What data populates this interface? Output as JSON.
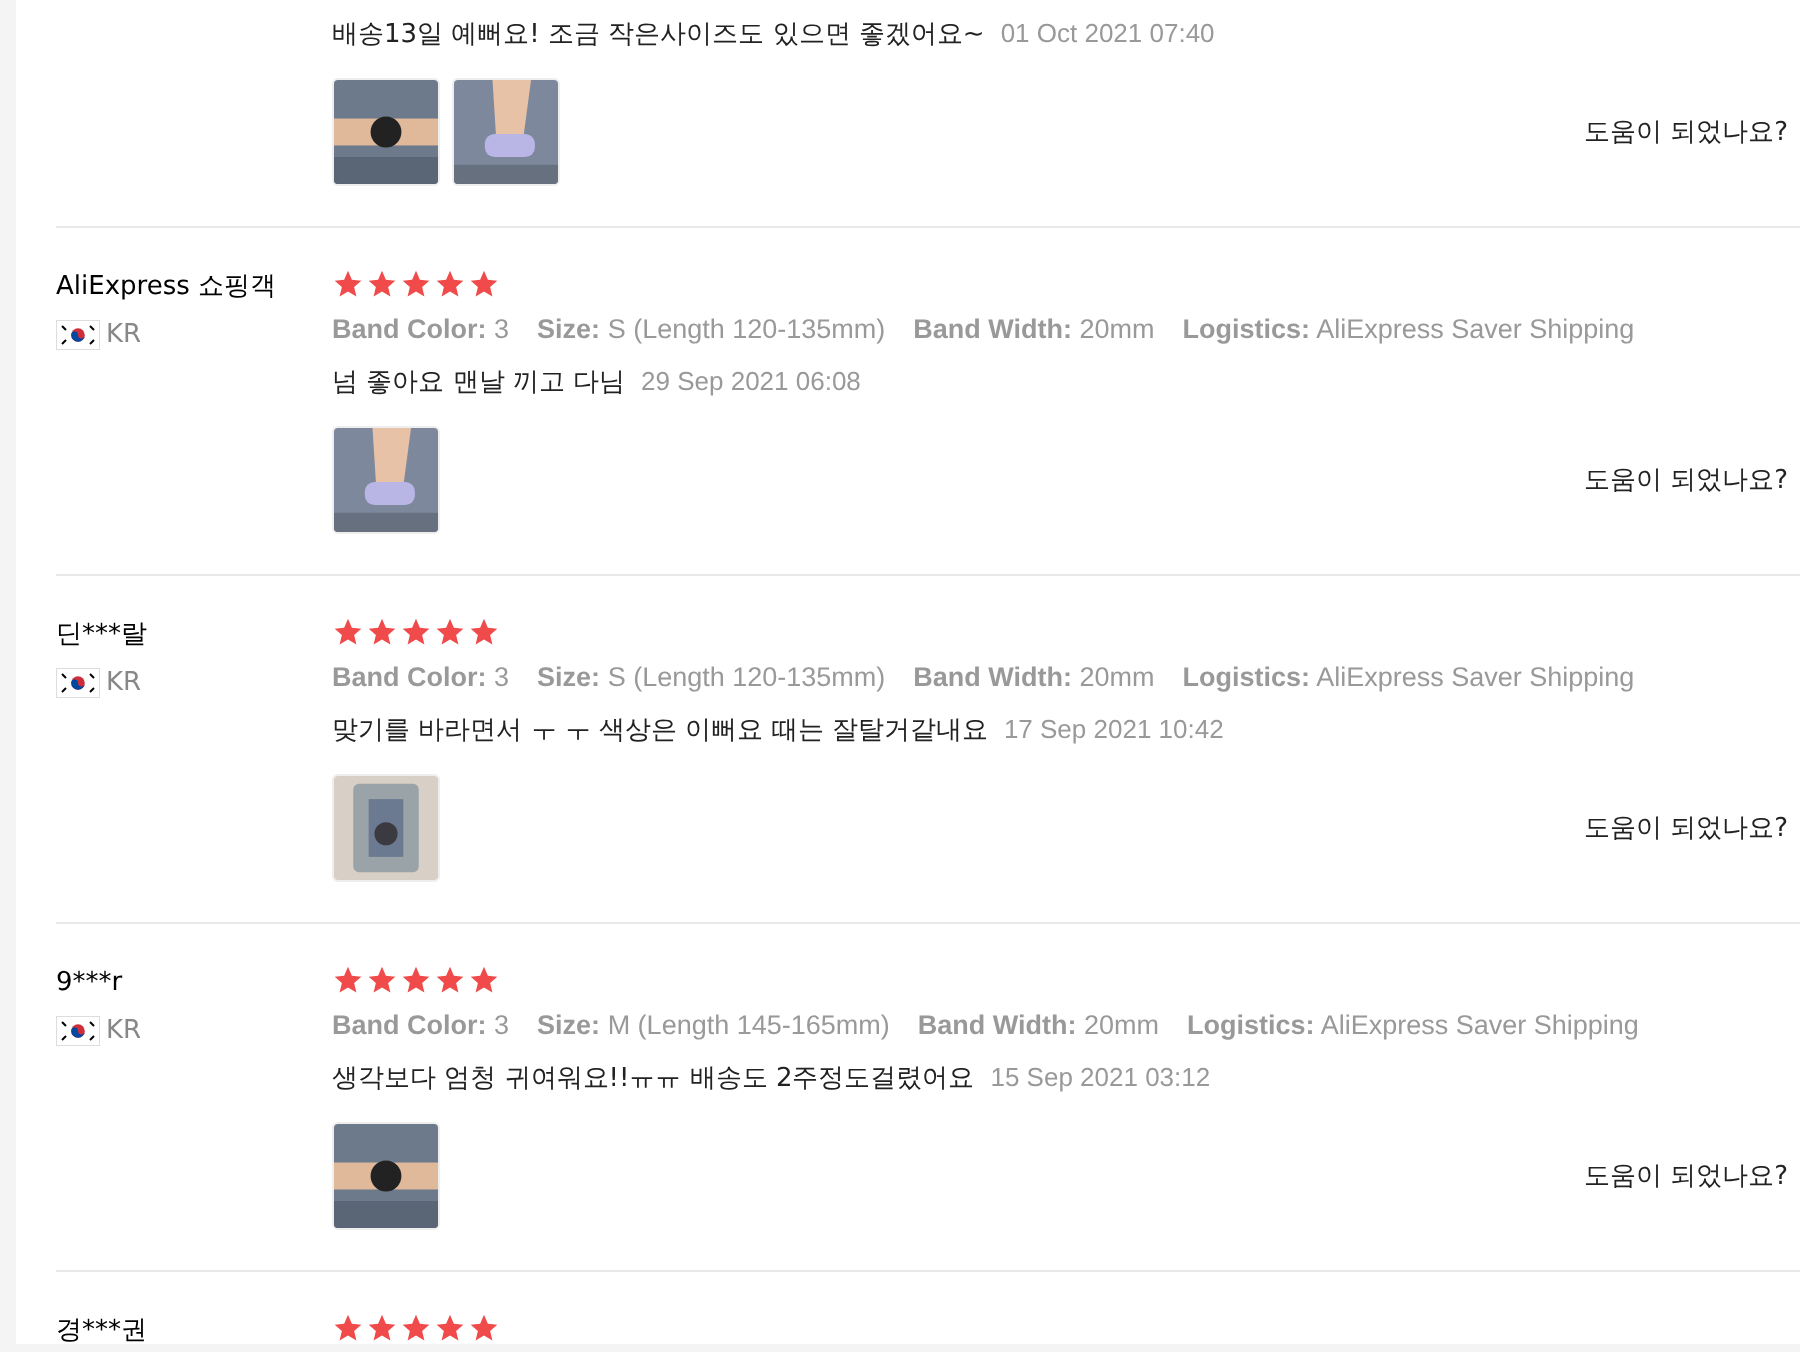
{
  "reviews": [
    {
      "text": "배송13일 예뻐요! 조금 작은사이즈도 있으면 좋겠어요~",
      "date": "01 Oct 2021 07:40",
      "photos": [
        {
          "kind": "picture"
        },
        {
          "kind": "picture"
        }
      ],
      "helpful": "도움이 되었나요?"
    },
    {
      "name": "AliExpress 쇼핑객",
      "country": "KR",
      "stars": 5,
      "attributes": [
        {
          "label": "Band Color:",
          "value": "3"
        },
        {
          "label": "Size:",
          "value": "S (Length 120-135mm)"
        },
        {
          "label": "Band Width:",
          "value": "20mm"
        },
        {
          "label": "Logistics:",
          "value": "AliExpress Saver Shipping"
        }
      ],
      "text": "넘 좋아요 맨날 끼고 다님",
      "date": "29 Sep 2021 06:08",
      "photos": [
        {
          "kind": "picture"
        }
      ],
      "helpful": "도움이 되었나요?"
    },
    {
      "name": "딘***랄",
      "country": "KR",
      "stars": 5,
      "attributes": [
        {
          "label": "Band Color:",
          "value": "3"
        },
        {
          "label": "Size:",
          "value": "S (Length 120-135mm)"
        },
        {
          "label": "Band Width:",
          "value": "20mm"
        },
        {
          "label": "Logistics:",
          "value": "AliExpress Saver Shipping"
        }
      ],
      "text": "맞기를 바라면서 ㅜ ㅜ 색상은 이뻐요 때는 잘탈거같내요",
      "date": "17 Sep 2021 10:42",
      "photos": [
        {
          "kind": "picture"
        }
      ],
      "helpful": "도움이 되었나요?"
    },
    {
      "name": "9***r",
      "country": "KR",
      "stars": 5,
      "attributes": [
        {
          "label": "Band Color:",
          "value": "3"
        },
        {
          "label": "Size:",
          "value": "M (Length 145-165mm)"
        },
        {
          "label": "Band Width:",
          "value": "20mm"
        },
        {
          "label": "Logistics:",
          "value": "AliExpress Saver Shipping"
        }
      ],
      "text": "생각보다 엄청 귀여워요!!ㅠㅠ 배송도 2주정도걸렸어요",
      "date": "15 Sep 2021 03:12",
      "photos": [
        {
          "kind": "picture"
        }
      ],
      "helpful": "도움이 되었나요?"
    },
    {
      "name": "경***권",
      "stars": 5
    }
  ]
}
